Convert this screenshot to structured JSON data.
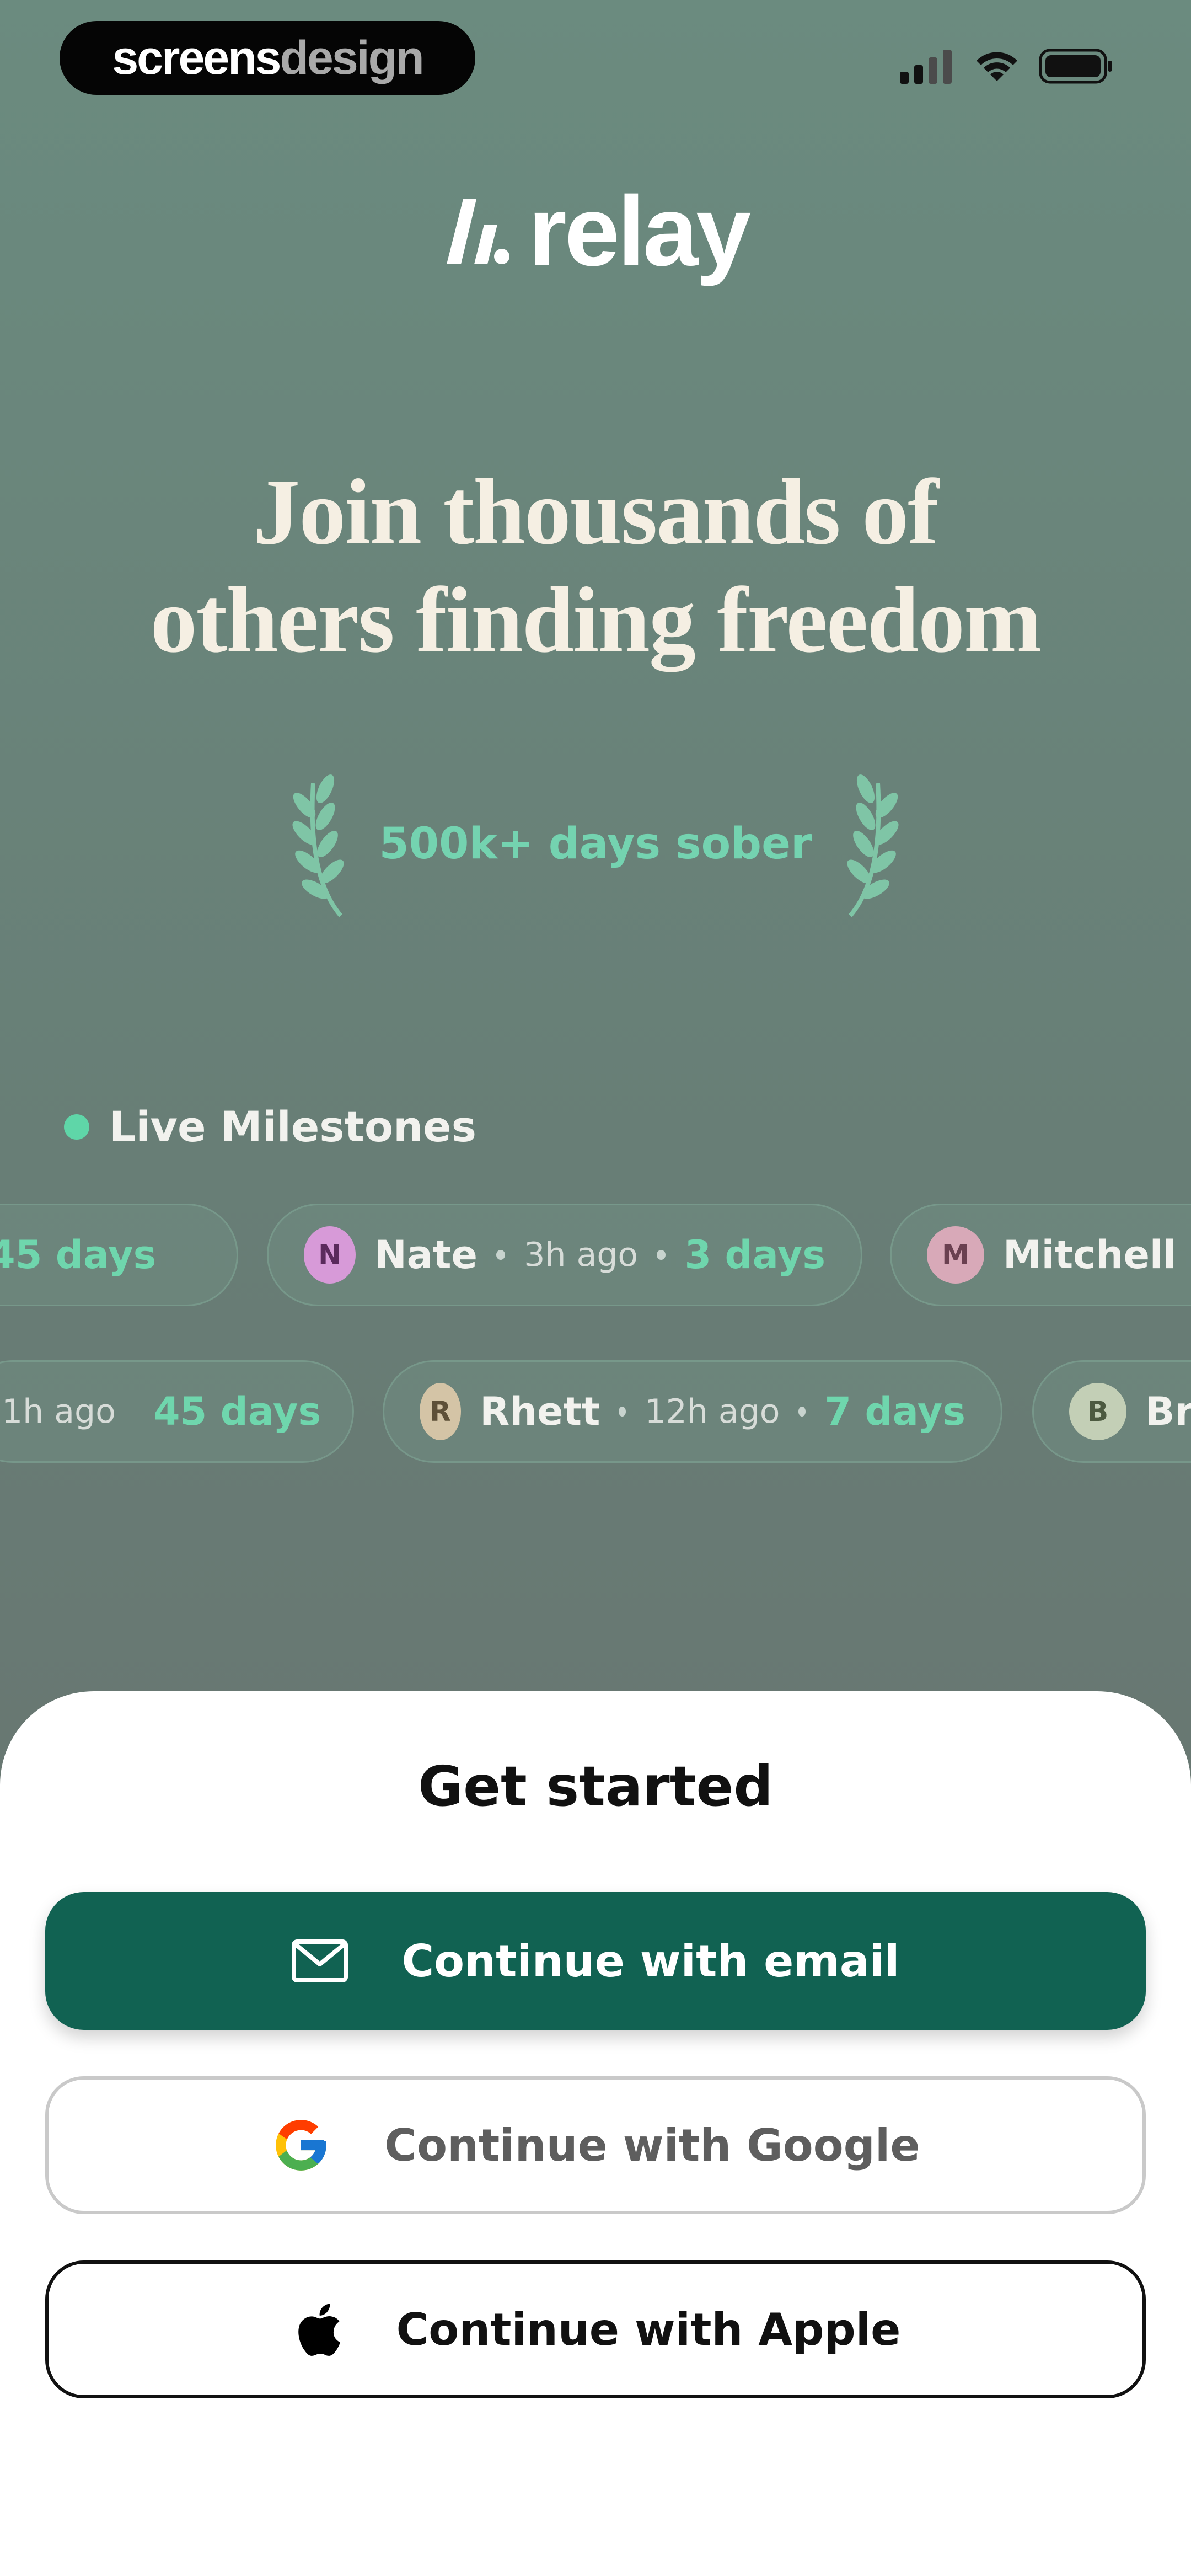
{
  "watermark": {
    "part1": "screens",
    "part2": "design"
  },
  "brand": {
    "name": "relay"
  },
  "headline": {
    "line1": "Join thousands of",
    "line2": "others finding freedom"
  },
  "stat": {
    "text": "500k+ days sober"
  },
  "live": {
    "label": "Live Milestones"
  },
  "milestones_row1": [
    {
      "days": "45 days"
    },
    {
      "initial": "N",
      "name": "Nate",
      "ago": "3h ago",
      "days": "3 days",
      "color": "#d79ad8"
    },
    {
      "initial": "M",
      "name": "Mitchell",
      "color": "#d8a9b8"
    }
  ],
  "milestones_row2": [
    {
      "ago": "1h ago",
      "days": "45 days"
    },
    {
      "initial": "R",
      "name": "Rhett",
      "ago": "12h ago",
      "days": "7 days",
      "color": "#d4c4a6"
    },
    {
      "initial": "B",
      "name": "Br",
      "color": "#c3cfb6"
    }
  ],
  "sheet": {
    "title": "Get started",
    "email_label": "Continue with email",
    "google_label": "Continue with Google",
    "apple_label": "Continue with Apple"
  },
  "colors": {
    "accent": "#116252",
    "mint": "#6fd6ad",
    "headline": "#f5efe3"
  },
  "icons": [
    "signal-icon",
    "wifi-icon",
    "battery-icon",
    "relay-logo-icon",
    "laurel-icon",
    "mail-icon",
    "google-icon",
    "apple-icon"
  ]
}
